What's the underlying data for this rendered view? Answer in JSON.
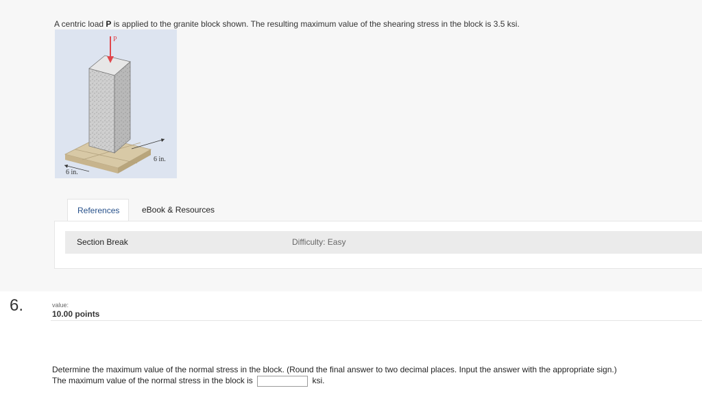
{
  "problem": {
    "text_before": "A centric load ",
    "bold": "P",
    "text_after": " is applied to the granite block shown. The resulting maximum value of the shearing stress in the block is 3.5 ksi."
  },
  "figure": {
    "load_label": "P",
    "dim_right": "6 in.",
    "dim_left": "6 in."
  },
  "tabs": [
    {
      "label": "References"
    },
    {
      "label": "eBook & Resources"
    }
  ],
  "reference_bar": {
    "section_label": "Section Break",
    "difficulty": "Difficulty: Easy"
  },
  "question": {
    "number": "6.",
    "value_label": "value:",
    "points": "10.00 points",
    "prompt": "Determine the maximum value of the normal stress in the block. (Round the final answer to two decimal places. Input the answer with the appropriate sign.)",
    "answer_prefix": "The maximum value of the normal stress in the block is",
    "answer_value": "",
    "answer_suffix": "ksi."
  },
  "colors": {
    "active_tab_text": "#26508a",
    "load_arrow": "#e0464b",
    "figure_background": "#dde4f0"
  }
}
